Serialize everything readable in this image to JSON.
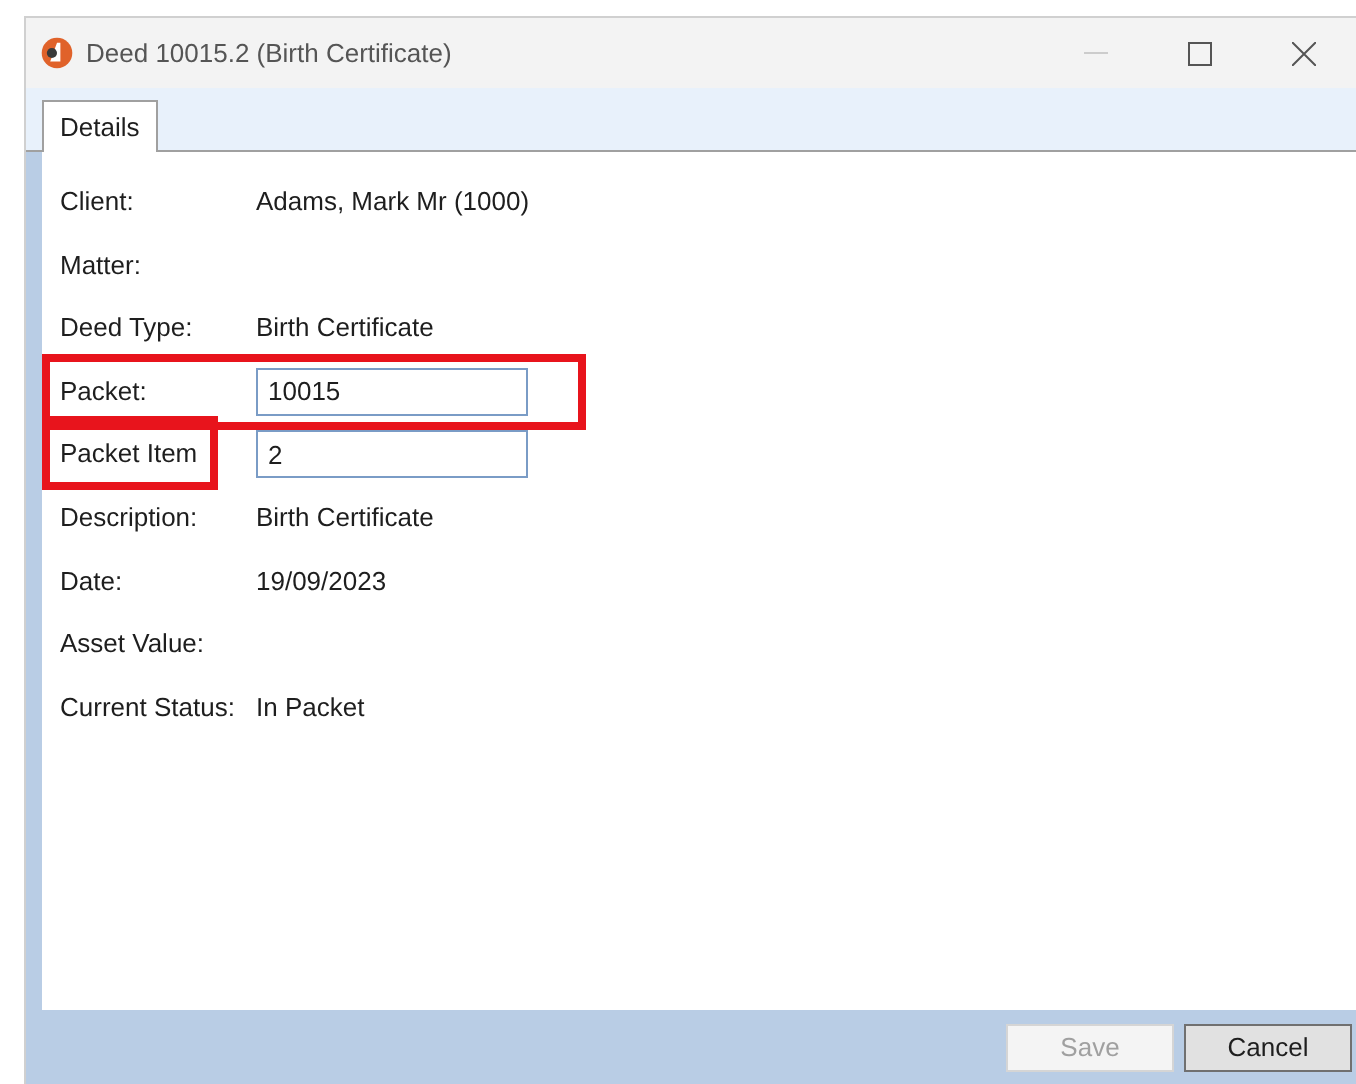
{
  "window": {
    "title": "Deed 10015.2 (Birth Certificate)"
  },
  "tabs": [
    {
      "label": "Details",
      "selected": true
    }
  ],
  "fields": [
    {
      "label": "Client:",
      "kind": "text",
      "value": "Adams, Mark Mr (1000)",
      "row_highlighted": false,
      "label_highlighted": false
    },
    {
      "label": "Matter:",
      "kind": "text",
      "row_highlighted": false,
      "label_highlighted": false
    },
    {
      "label": "Deed Type:",
      "kind": "text",
      "value": "Birth Certificate",
      "row_highlighted": false,
      "label_highlighted": false
    },
    {
      "label": "Packet:",
      "kind": "input",
      "value": "10015",
      "row_highlighted": true,
      "label_highlighted": false
    },
    {
      "label": "Packet Item",
      "kind": "input",
      "value": "2",
      "row_highlighted": false,
      "label_highlighted": true
    },
    {
      "label": "Description:",
      "kind": "text",
      "value": "Birth Certificate",
      "row_highlighted": false,
      "label_highlighted": false
    },
    {
      "label": "Date:",
      "kind": "text",
      "value": "19/09/2023",
      "row_highlighted": false,
      "label_highlighted": false
    },
    {
      "label": "Asset Value:",
      "kind": "text",
      "row_highlighted": false,
      "label_highlighted": false
    },
    {
      "label": "Current Status:",
      "kind": "text",
      "value": "In Packet",
      "row_highlighted": false,
      "label_highlighted": false
    }
  ],
  "buttons": [
    {
      "label": "Save",
      "disabled": true
    },
    {
      "label": "Cancel",
      "disabled": false
    }
  ]
}
